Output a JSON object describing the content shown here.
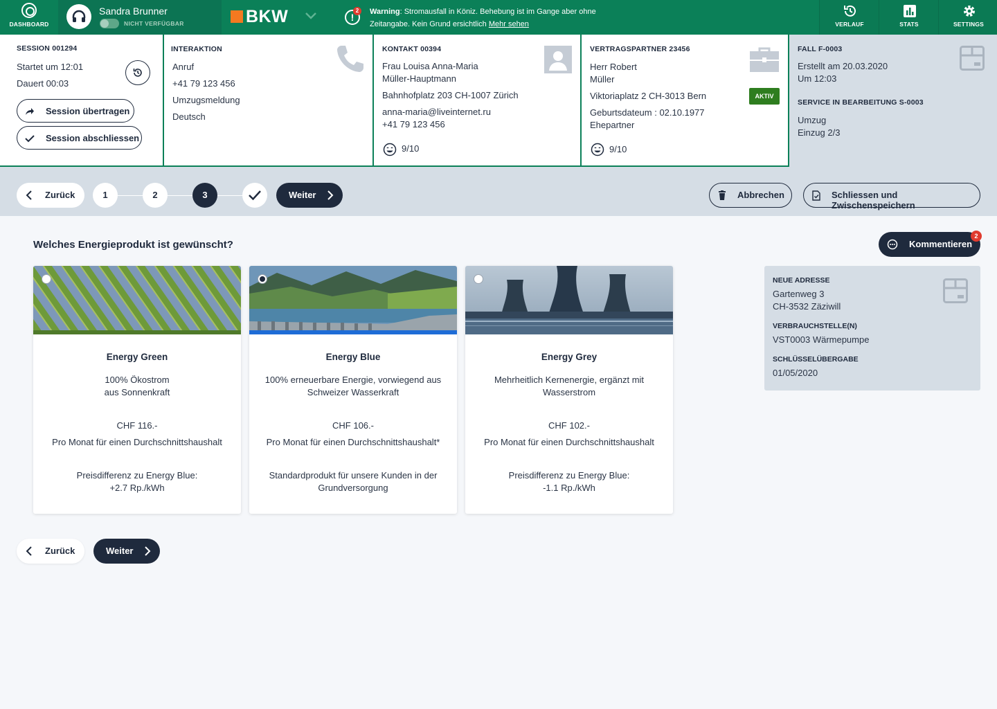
{
  "topbar": {
    "dashboard_label": "DASHBOARD",
    "user_name": "Sandra Brunner",
    "user_status": "NICHT VERFÜGBAR",
    "brand": "BKW",
    "warning_badge": "2",
    "warning_title": "Warning",
    "warning_text": ": Stromausfall in Köniz. Behebung ist im Gange aber ohne Zeitangabe. Kein Grund ersichtlich",
    "warning_link": "Mehr sehen",
    "nav": [
      {
        "label": "VERLAUF",
        "icon": "history-icon"
      },
      {
        "label": "STATS",
        "icon": "stats-icon"
      },
      {
        "label": "SETTINGS",
        "icon": "gear-icon"
      }
    ]
  },
  "session": {
    "title": "SESSION 001294",
    "started": "Startet um 12:01",
    "duration": "Dauert 00:03",
    "transfer_label": "Session übertragen",
    "close_label": "Session abschliessen"
  },
  "interaction": {
    "title": "INTERAKTION",
    "lines": [
      "Anruf",
      "+41 79 123 456",
      "Umzugsmeldung",
      "Deutsch"
    ]
  },
  "contact": {
    "title": "KONTAKT 00394",
    "name1": "Frau Louisa Anna-Maria",
    "name2": "Müller-Hauptmann",
    "address": "Bahnhofplatz 203 CH-1007 Zürich",
    "email": "anna-maria@liveinternet.ru",
    "phone": "+41 79 123 456",
    "score": "9/10"
  },
  "partner": {
    "title": "VERTRAGSPARTNER 23456",
    "name1": "Herr Robert",
    "name2": "Müller",
    "address": "Viktoriaplatz 2 CH-3013 Bern",
    "status": "AKTIV",
    "birth": "Geburtsdateum : 02.10.1977",
    "relation": "Ehepartner",
    "score": "9/10"
  },
  "fall": {
    "title": "FALL F-0003",
    "created": "Erstellt am 20.03.2020",
    "time": "Um 12:03",
    "service_title": "SERVICE IN BEARBEITUNG S-0003",
    "service_type": "Umzug",
    "service_step": "Einzug 2/3"
  },
  "stepbar": {
    "back_label": "Zurück",
    "next_label": "Weiter",
    "steps": [
      "1",
      "2",
      "3"
    ],
    "cancel_label": "Abbrechen",
    "save_label": "Schliessen und Zwischenspeichern"
  },
  "main": {
    "question": "Welches Energieprodukt ist gewünscht?",
    "comment_label": "Kommentieren",
    "comment_badge": "2",
    "cards": [
      {
        "name": "Energy Green",
        "desc1": "100% Ökostrom",
        "desc2": "aus Sonnenkraft",
        "price": "CHF 116.-",
        "price_note": "Pro Monat für einen Durchschnittshaushalt",
        "diff1": "Preisdifferenz zu Energy Blue:",
        "diff2": "+2.7 Rp./kWh",
        "selected": false
      },
      {
        "name": "Energy Blue",
        "desc1": "100% erneuerbare Energie, vorwiegend aus",
        "desc2": "Schweizer Wasserkraft",
        "price": "CHF 106.-",
        "price_note": "Pro Monat für einen Durchschnittshaushalt*",
        "diff1": "Standardprodukt für unsere Kunden in der",
        "diff2": "Grundversorgung",
        "selected": true
      },
      {
        "name": "Energy Grey",
        "desc1": "Mehrheitlich Kernenergie, ergänzt mit",
        "desc2": "Wasserstrom",
        "price": "CHF 102.-",
        "price_note": "Pro Monat für einen Durchschnittshaushalt",
        "diff1": "Preisdifferenz zu Energy Blue:",
        "diff2": "-1.1 Rp./kWh",
        "selected": false
      }
    ],
    "back_label": "Zurück",
    "next_label": "Weiter"
  },
  "sidebox": {
    "address_title": "NEUE ADRESSE",
    "address1": "Gartenweg 3",
    "address2": "CH-3532 Zäziwill",
    "consumption_title": "VERBRAUCHSTELLE(N)",
    "consumption": "VST0003 Wärmepumpe",
    "key_title": "SCHLÜSSELÜBERGABE",
    "key_date": "01/05/2020"
  },
  "colors": {
    "primary_green": "#0b8058",
    "dark_navy": "#1f2a3d",
    "panel_grey": "#d5dde5",
    "brand_orange": "#f47920",
    "alert_red": "#e03b2f",
    "status_green": "#2e7d1f"
  }
}
